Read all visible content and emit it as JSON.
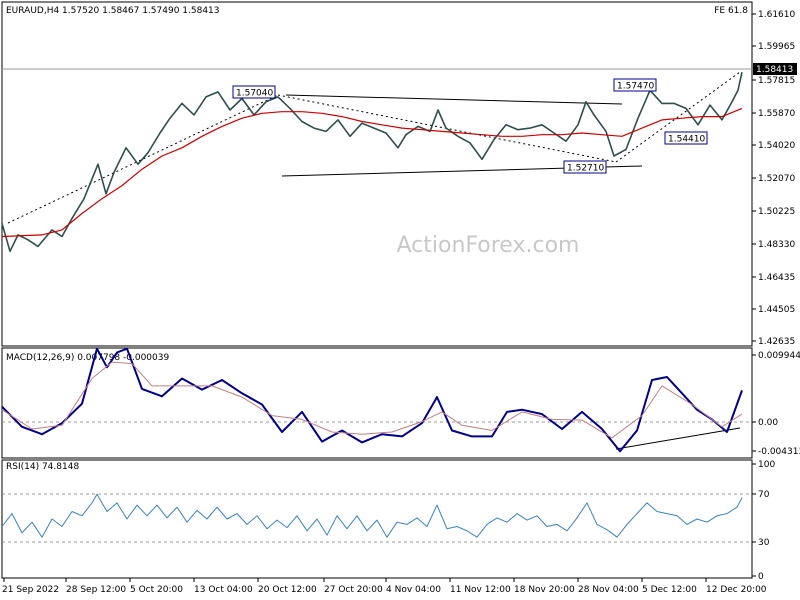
{
  "main_panel": {
    "header": "EURAUD,H4  1.57520 1.58467 1.57490 1.58413",
    "fe_label": "FE 61.8",
    "watermark": "ActionForex.com",
    "current_price": "1.58413",
    "price_ticks": [
      "1.61610",
      "1.59965",
      "1.57815",
      "1.55870",
      "1.54020",
      "1.52070",
      "1.50225",
      "1.48330",
      "1.46435",
      "1.44505",
      "1.42635"
    ],
    "annotations": [
      "1.57040",
      "1.57470",
      "1.54410",
      "1.52710"
    ]
  },
  "macd_panel": {
    "header": "MACD(12,26,9) 0.007798 -0.000039",
    "ticks": [
      "0.009944",
      "0.00",
      "-0.004313"
    ]
  },
  "rsi_panel": {
    "header": "RSI(14) 74.8148",
    "ticks": [
      "100",
      "70",
      "30",
      "0"
    ]
  },
  "time_axis": [
    "21 Sep 2022",
    "28 Sep 12:00",
    "5 Oct 20:00",
    "13 Oct 04:00",
    "20 Oct 12:00",
    "27 Oct 20:00",
    "4 Nov 04:00",
    "11 Nov 12:00",
    "18 Nov 20:00",
    "28 Nov 04:00",
    "5 Dec 12:00",
    "12 Dec 20:00"
  ],
  "colors": {
    "candles": "#2f4f4f",
    "ma": "#cc0000",
    "macd_line": "#00008b",
    "macd_signal": "#c08080",
    "rsi_line": "#3b82c4",
    "trendline": "#000000"
  },
  "chart_data": [
    {
      "type": "line",
      "title": "EURAUD,H4",
      "ylim": [
        1.41735,
        1.62675
      ],
      "series": [
        {
          "name": "EURAUD,H4",
          "points": [
            [
              0,
              1.492
            ],
            [
              8,
              1.475
            ],
            [
              16,
              1.485
            ],
            [
              26,
              1.482
            ],
            [
              36,
              1.478
            ],
            [
              50,
              1.488
            ],
            [
              60,
              1.484
            ],
            [
              70,
              1.495
            ],
            [
              82,
              1.507
            ],
            [
              96,
              1.528
            ],
            [
              104,
              1.51
            ],
            [
              112,
              1.523
            ],
            [
              124,
              1.538
            ],
            [
              136,
              1.528
            ],
            [
              146,
              1.535
            ],
            [
              158,
              1.547
            ],
            [
              168,
              1.556
            ],
            [
              180,
              1.565
            ],
            [
              192,
              1.558
            ],
            [
              204,
              1.569
            ],
            [
              216,
              1.572
            ],
            [
              228,
              1.561
            ],
            [
              240,
              1.568
            ],
            [
              252,
              1.558
            ],
            [
              264,
              1.566
            ],
            [
              276,
              1.569
            ],
            [
              288,
              1.562
            ],
            [
              300,
              1.554
            ],
            [
              312,
              1.55
            ],
            [
              324,
              1.548
            ],
            [
              336,
              1.555
            ],
            [
              348,
              1.545
            ],
            [
              360,
              1.553
            ],
            [
              372,
              1.55
            ],
            [
              384,
              1.547
            ],
            [
              396,
              1.538
            ],
            [
              404,
              1.546
            ],
            [
              416,
              1.551
            ],
            [
              428,
              1.548
            ],
            [
              436,
              1.561
            ],
            [
              444,
              1.55
            ],
            [
              456,
              1.545
            ],
            [
              468,
              1.541
            ],
            [
              480,
              1.531
            ],
            [
              492,
              1.543
            ],
            [
              504,
              1.552
            ],
            [
              516,
              1.549
            ],
            [
              528,
              1.55
            ],
            [
              540,
              1.552
            ],
            [
              552,
              1.547
            ],
            [
              564,
              1.542
            ],
            [
              576,
              1.552
            ],
            [
              584,
              1.566
            ],
            [
              592,
              1.558
            ],
            [
              604,
              1.548
            ],
            [
              612,
              1.533
            ],
            [
              624,
              1.537
            ],
            [
              636,
              1.556
            ],
            [
              648,
              1.573
            ],
            [
              660,
              1.565
            ],
            [
              672,
              1.565
            ],
            [
              684,
              1.562
            ],
            [
              696,
              1.552
            ],
            [
              708,
              1.564
            ],
            [
              720,
              1.555
            ],
            [
              730,
              1.566
            ],
            [
              736,
              1.573
            ],
            [
              740,
              1.584
            ]
          ]
        },
        {
          "name": "",
          "points": [
            [
              0,
              1.484
            ],
            [
              40,
              1.485
            ],
            [
              60,
              1.488
            ],
            [
              80,
              1.498
            ],
            [
              100,
              1.507
            ],
            [
              120,
              1.515
            ],
            [
              140,
              1.525
            ],
            [
              160,
              1.533
            ],
            [
              180,
              1.538
            ],
            [
              200,
              1.545
            ],
            [
              220,
              1.551
            ],
            [
              240,
              1.556
            ],
            [
              260,
              1.559
            ],
            [
              280,
              1.56
            ],
            [
              300,
              1.56
            ],
            [
              320,
              1.559
            ],
            [
              340,
              1.557
            ],
            [
              360,
              1.554
            ],
            [
              380,
              1.552
            ],
            [
              400,
              1.55
            ],
            [
              420,
              1.549
            ],
            [
              440,
              1.548
            ],
            [
              460,
              1.547
            ],
            [
              480,
              1.546
            ],
            [
              500,
              1.545
            ],
            [
              520,
              1.545
            ],
            [
              540,
              1.546
            ],
            [
              560,
              1.546
            ],
            [
              580,
              1.547
            ],
            [
              600,
              1.546
            ],
            [
              620,
              1.545
            ],
            [
              640,
              1.55
            ],
            [
              660,
              1.555
            ],
            [
              680,
              1.556
            ],
            [
              700,
              1.557
            ],
            [
              720,
              1.557
            ],
            [
              740,
              1.562
            ]
          ]
        }
      ]
    },
    {
      "type": "line",
      "title": "MACD(12,26,9)",
      "ylim": [
        -0.0047,
        0.0101
      ],
      "series": [
        {
          "name": "MACD(12,26,9)",
          "points": [
            [
              0,
              0.0022
            ],
            [
              20,
              -0.0005
            ],
            [
              40,
              -0.0015
            ],
            [
              60,
              0.0
            ],
            [
              80,
              0.0026
            ],
            [
              95,
              0.01
            ],
            [
              105,
              0.0075
            ],
            [
              115,
              0.0095
            ],
            [
              125,
              0.01
            ],
            [
              140,
              0.0046
            ],
            [
              160,
              0.0036
            ],
            [
              180,
              0.006
            ],
            [
              200,
              0.0045
            ],
            [
              220,
              0.0058
            ],
            [
              240,
              0.004
            ],
            [
              260,
              0.0025
            ],
            [
              280,
              -0.0012
            ],
            [
              300,
              0.0015
            ],
            [
              320,
              -0.0025
            ],
            [
              340,
              -0.001
            ],
            [
              360,
              -0.0026
            ],
            [
              380,
              -0.0015
            ],
            [
              400,
              -0.0018
            ],
            [
              420,
              0.0
            ],
            [
              435,
              0.0035
            ],
            [
              450,
              -0.001
            ],
            [
              470,
              -0.0018
            ],
            [
              490,
              -0.0018
            ],
            [
              505,
              0.0015
            ],
            [
              520,
              0.0018
            ],
            [
              540,
              0.0012
            ],
            [
              560,
              -0.0008
            ],
            [
              580,
              0.0015
            ],
            [
              600,
              -0.0008
            ],
            [
              618,
              -0.0038
            ],
            [
              635,
              -0.001
            ],
            [
              650,
              0.0058
            ],
            [
              665,
              0.0062
            ],
            [
              680,
              0.004
            ],
            [
              695,
              0.0018
            ],
            [
              710,
              0.0005
            ],
            [
              725,
              -0.0012
            ],
            [
              740,
              0.0044
            ]
          ]
        },
        {
          "name": "",
          "points": [
            [
              0,
              0.0018
            ],
            [
              30,
              -0.0008
            ],
            [
              60,
              -0.0003
            ],
            [
              90,
              0.006
            ],
            [
              110,
              0.0082
            ],
            [
              130,
              0.008
            ],
            [
              150,
              0.005
            ],
            [
              180,
              0.005
            ],
            [
              210,
              0.005
            ],
            [
              240,
              0.0035
            ],
            [
              270,
              0.001
            ],
            [
              300,
              0.0005
            ],
            [
              330,
              -0.0012
            ],
            [
              360,
              -0.0015
            ],
            [
              390,
              -0.0012
            ],
            [
              420,
              0.0002
            ],
            [
              440,
              0.0015
            ],
            [
              460,
              -0.0003
            ],
            [
              490,
              -0.001
            ],
            [
              520,
              0.0015
            ],
            [
              550,
              0.0005
            ],
            [
              580,
              0.0004
            ],
            [
              610,
              -0.002
            ],
            [
              640,
              0.001
            ],
            [
              660,
              0.005
            ],
            [
              690,
              0.0025
            ],
            [
              720,
              -0.0005
            ],
            [
              740,
              0.0012
            ]
          ]
        }
      ]
    },
    {
      "type": "line",
      "title": "RSI(14)",
      "ylim": [
        0,
        110
      ],
      "series": [
        {
          "name": "RSI(14)",
          "points": [
            [
              0,
              48
            ],
            [
              10,
              60
            ],
            [
              20,
              42
            ],
            [
              30,
              52
            ],
            [
              40,
              38
            ],
            [
              50,
              55
            ],
            [
              60,
              48
            ],
            [
              70,
              62
            ],
            [
              80,
              58
            ],
            [
              90,
              70
            ],
            [
              95,
              78
            ],
            [
              105,
              62
            ],
            [
              115,
              70
            ],
            [
              125,
              55
            ],
            [
              135,
              68
            ],
            [
              145,
              58
            ],
            [
              155,
              68
            ],
            [
              165,
              56
            ],
            [
              175,
              66
            ],
            [
              185,
              52
            ],
            [
              195,
              63
            ],
            [
              205,
              55
            ],
            [
              215,
              66
            ],
            [
              225,
              55
            ],
            [
              235,
              60
            ],
            [
              245,
              50
            ],
            [
              255,
              58
            ],
            [
              265,
              46
            ],
            [
              275,
              54
            ],
            [
              285,
              47
            ],
            [
              295,
              58
            ],
            [
              305,
              44
            ],
            [
              315,
              55
            ],
            [
              325,
              40
            ],
            [
              335,
              58
            ],
            [
              345,
              46
            ],
            [
              355,
              58
            ],
            [
              365,
              44
            ],
            [
              375,
              54
            ],
            [
              385,
              38
            ],
            [
              395,
              52
            ],
            [
              405,
              50
            ],
            [
              415,
              56
            ],
            [
              425,
              48
            ],
            [
              435,
              68
            ],
            [
              445,
              46
            ],
            [
              455,
              48
            ],
            [
              465,
              44
            ],
            [
              475,
              38
            ],
            [
              485,
              50
            ],
            [
              495,
              56
            ],
            [
              505,
              52
            ],
            [
              515,
              60
            ],
            [
              525,
              54
            ],
            [
              535,
              58
            ],
            [
              545,
              48
            ],
            [
              555,
              50
            ],
            [
              565,
              44
            ],
            [
              575,
              56
            ],
            [
              585,
              70
            ],
            [
              595,
              50
            ],
            [
              605,
              45
            ],
            [
              615,
              38
            ],
            [
              625,
              50
            ],
            [
              635,
              60
            ],
            [
              645,
              70
            ],
            [
              655,
              62
            ],
            [
              665,
              60
            ],
            [
              675,
              58
            ],
            [
              685,
              50
            ],
            [
              695,
              55
            ],
            [
              705,
              52
            ],
            [
              715,
              58
            ],
            [
              725,
              60
            ],
            [
              735,
              66
            ],
            [
              740,
              75
            ]
          ]
        }
      ]
    }
  ]
}
